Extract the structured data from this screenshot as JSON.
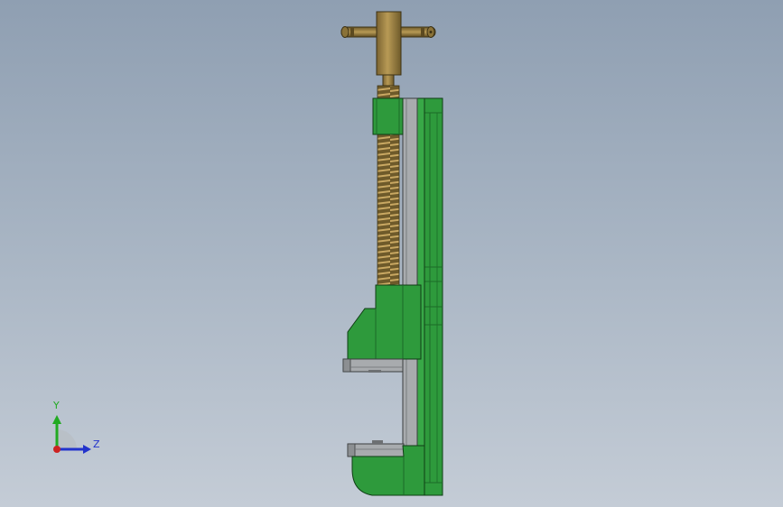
{
  "viewport": {
    "background_top": "#8f9fb2",
    "background_bottom": "#c4ccd6"
  },
  "model": {
    "colors": {
      "body_green": "#2e9a3c",
      "body_green_dark": "#1c6b27",
      "steel_gray": "#a8abae",
      "steel_gray_dark": "#6d7073",
      "brass": "#a68b47",
      "brass_dark": "#6e5a2a",
      "thread": "#b08a4a"
    }
  },
  "triad": {
    "labels": {
      "y": "Y",
      "z": "Z"
    },
    "colors": {
      "y": "#22aa22",
      "z": "#2233cc",
      "x": "#cc2222"
    }
  }
}
